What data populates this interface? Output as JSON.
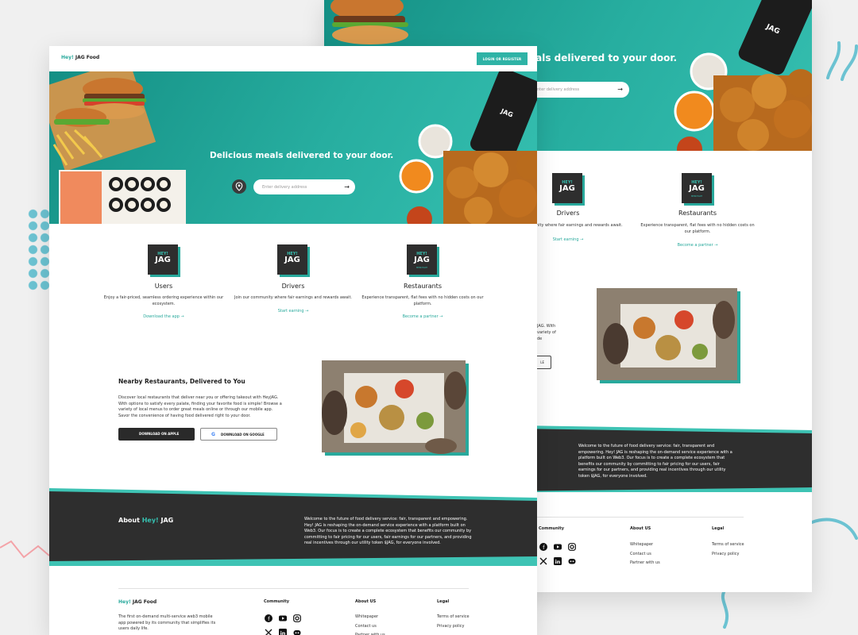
{
  "colors": {
    "accent": "#28a99c",
    "dark": "#2e2e2e",
    "teal_bg": "#27aea0"
  },
  "nav": {
    "logo_hey": "Hey!",
    "logo_rest": " JAG Food",
    "login_label": "LOGIN OR REGISTER"
  },
  "hero": {
    "title": "Delicious meals delivered to your door.",
    "back_title": "eals delivered to your door.",
    "address_placeholder": "Enter delivery address",
    "back_address_placeholder": "nter delivery address",
    "arrow_icon": "arrow-right-icon",
    "pin_icon": "map-pin-icon"
  },
  "services": [
    {
      "title": "Users",
      "desc": "Enjoy a fair-priced, seamless ordering experience within our ecosystem.",
      "link": "Download the app"
    },
    {
      "title": "Drivers",
      "desc": "Join our community where fair earnings and rewards await.",
      "link": "Start earning"
    },
    {
      "title": "Restaurants",
      "desc": "Experience transparent, flat fees with no hidden costs on our platform.",
      "link": "Become a partner"
    }
  ],
  "back_services": [
    {
      "title": "Drivers",
      "desc": "our community where fair earnings and rewards await.",
      "link": "Start earning"
    },
    {
      "title": "Restaurants",
      "desc": "Experience transparent, flat fees with no hidden costs on our platform.",
      "link": "Become a partner"
    }
  ],
  "jag_logo": {
    "hey": "HEY!",
    "jag": "JAG",
    "sub": "MERCHANT"
  },
  "nearby": {
    "title": "Nearby Restaurants, Delivered to You",
    "desc": "Discover local restaurants that deliver near you or offering takeout with HeyJAG. With options to satisfy every palate, finding your favorite food is simple! Browse a variety of local menus to order great meals online or through our mobile app. Savor the convenience of having food delivered right to your door.",
    "apple_label": "DOWNLOAD ON APPLE",
    "google_label": "DOWNLOAD ON GOOGLE",
    "back_fragment": "JAG. With\nvariety of\nde",
    "back_button": "LE"
  },
  "about": {
    "title_pre": "About ",
    "title_hey": "Hey!",
    "title_post": " JAG",
    "text": "Welcome to the future of food delivery service: fair, transparent and empowering. Hey! JAG is reshaping the on-demand service experience with a platform built on Web3. Our focus is to create a complete ecosystem that benefits our community by committing to fair pricing for our users, fair earnings for our partners, and providing real incentives through our utility token $JAG, for everyone involved."
  },
  "footer": {
    "logo_hey": "Hey!",
    "logo_rest": " JAG Food",
    "tagline": "The first on-demand multi-service web3 mobile app powered by its community that simplifies its users daily life.",
    "community_heading": "Community",
    "about_heading": "About US",
    "legal_heading": "Legal",
    "about_links": [
      "Whitepaper",
      "Contact us",
      "Partner with us"
    ],
    "legal_links": [
      "Terms of service",
      "Privacy policy"
    ],
    "social_icons": [
      "facebook-icon",
      "youtube-icon",
      "instagram-icon",
      "x-twitter-icon",
      "linkedin-icon",
      "discord-icon"
    ]
  }
}
